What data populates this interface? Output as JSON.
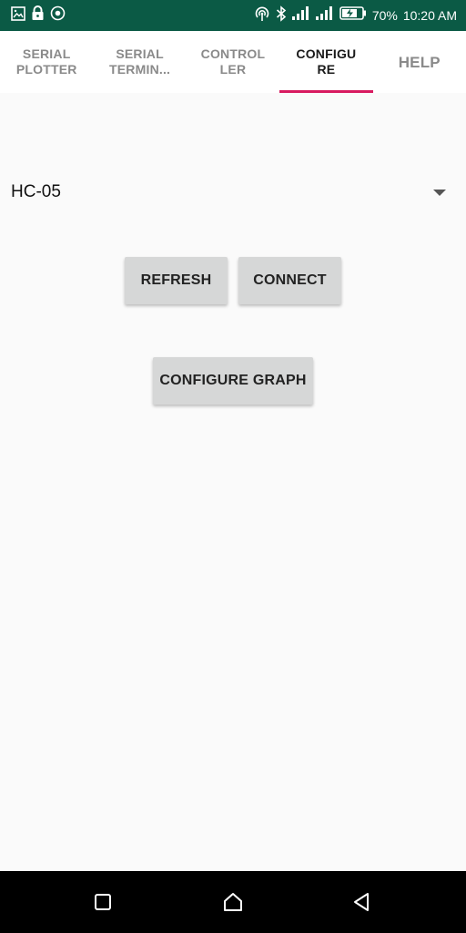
{
  "status_bar": {
    "left_icons": [
      "gallery-icon",
      "lock-icon",
      "sync-icon"
    ],
    "right_icons": [
      "hotspot-icon",
      "bluetooth-icon",
      "signal-icon",
      "signal-icon",
      "battery-charging-icon"
    ],
    "battery": "70%",
    "time": "10:20 AM",
    "bg_color": "#0b5a45"
  },
  "tabs": [
    {
      "label": "SERIAL\nPLOTTER",
      "active": false
    },
    {
      "label": "SERIAL\nTERMIN...",
      "active": false
    },
    {
      "label": "CONTROL\nLER",
      "active": false
    },
    {
      "label": "CONFIGU\nRE",
      "active": true
    },
    {
      "label": "HELP",
      "active": false
    }
  ],
  "tab_indicator_color": "#d81b60",
  "device_spinner": {
    "value": "HC-05"
  },
  "buttons": {
    "refresh": "REFRESH",
    "connect": "CONNECT",
    "configure_graph": "CONFIGURE GRAPH"
  },
  "nav_bar": {
    "icons": [
      "recent-apps-icon",
      "home-icon",
      "back-icon"
    ]
  }
}
